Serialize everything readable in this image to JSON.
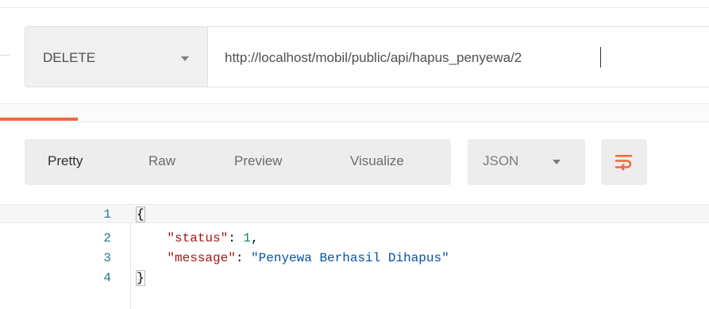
{
  "request": {
    "method": "DELETE",
    "url": "http://localhost/mobil/public/api/hapus_penyewa/2"
  },
  "response": {
    "view_tabs": [
      "Pretty",
      "Raw",
      "Preview",
      "Visualize"
    ],
    "active_view": "Pretty",
    "format": "JSON",
    "lines": [
      {
        "num": "1",
        "text": "{"
      },
      {
        "num": "2",
        "key": "\"status\"",
        "sep": ": ",
        "value": "1",
        "end": ","
      },
      {
        "num": "3",
        "key": "\"message\"",
        "sep": ": ",
        "value": "\"Penyewa Berhasil Dihapus\"",
        "end": ""
      },
      {
        "num": "4",
        "text": "}"
      }
    ]
  },
  "colors": {
    "accent_tab_underline": "#f26b3a",
    "wrap_icon": "#f26b3a",
    "json_key": "#a31515",
    "json_string": "#0451a5",
    "json_number": "#098658",
    "line_number": "#237893"
  },
  "icons": {
    "method_dropdown": "chevron-down-icon",
    "format_dropdown": "chevron-down-icon",
    "wrap": "wrap-lines-icon"
  }
}
